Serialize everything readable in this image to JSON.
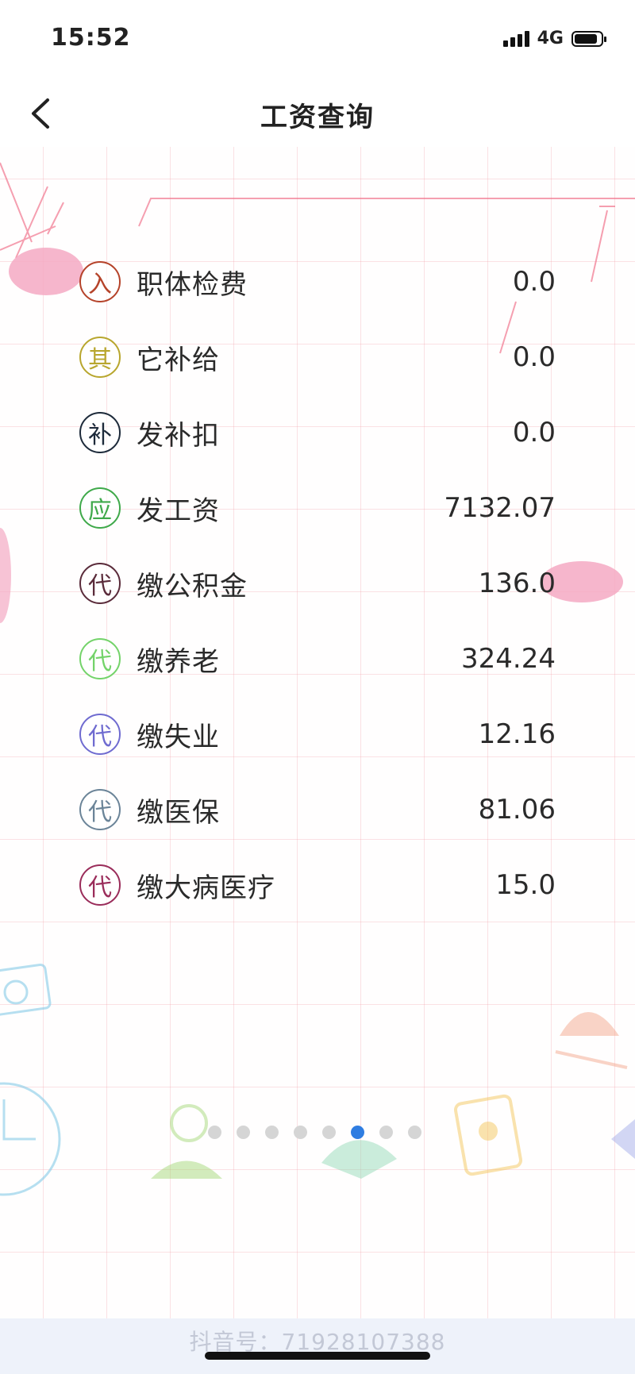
{
  "status_bar": {
    "time": "15:52",
    "network": "4G"
  },
  "header": {
    "title": "工资查询"
  },
  "salary_items": [
    {
      "badge": "入",
      "badge_color": "#b5432a",
      "label": "职体检费",
      "value": "0.0"
    },
    {
      "badge": "其",
      "badge_color": "#b8a62e",
      "label": "它补给",
      "value": "0.0"
    },
    {
      "badge": "补",
      "badge_color": "#1d2a3a",
      "label": "发补扣",
      "value": "0.0"
    },
    {
      "badge": "应",
      "badge_color": "#3fa94a",
      "label": "发工资",
      "value": "7132.07"
    },
    {
      "badge": "代",
      "badge_color": "#5a2b3a",
      "label": "缴公积金",
      "value": "136.0"
    },
    {
      "badge": "代",
      "badge_color": "#74d36a",
      "label": "缴养老",
      "value": "324.24"
    },
    {
      "badge": "代",
      "badge_color": "#6f6bd0",
      "label": "缴失业",
      "value": "12.16"
    },
    {
      "badge": "代",
      "badge_color": "#6b8498",
      "label": "缴医保",
      "value": "81.06"
    },
    {
      "badge": "代",
      "badge_color": "#9a2c5a",
      "label": "缴大病医疗",
      "value": "15.0"
    }
  ],
  "pager": {
    "total": 8,
    "active_index": 5
  },
  "footer": {
    "watermark": "抖音号：71928107388"
  },
  "icons": [
    "back-chevron-icon",
    "signal-icon",
    "battery-icon"
  ]
}
